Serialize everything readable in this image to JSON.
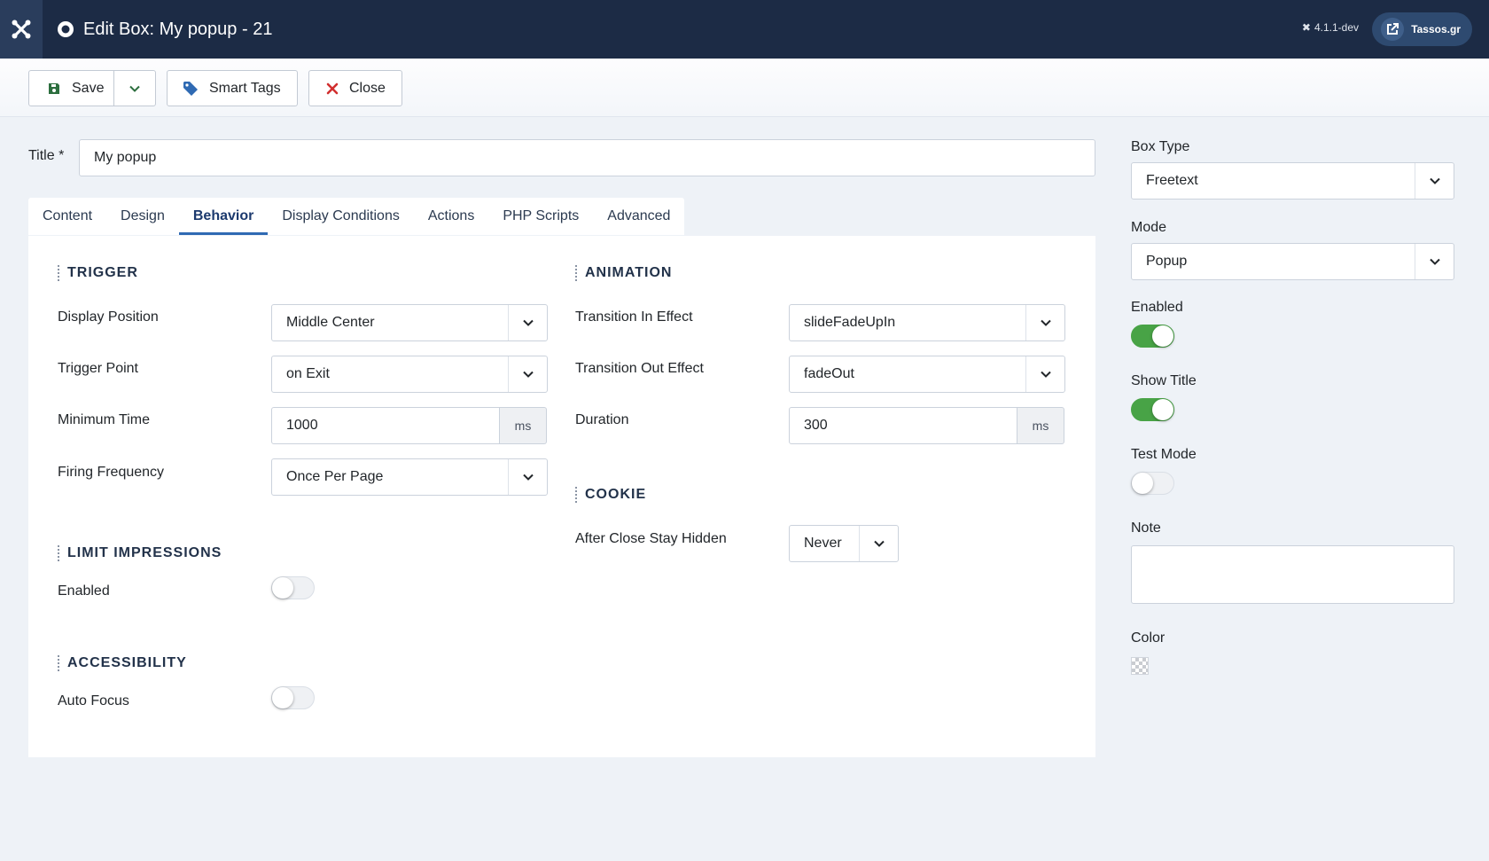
{
  "header": {
    "title": "Edit Box: My popup - 21",
    "version": "4.1.1-dev",
    "site_label": "Tassos.gr"
  },
  "toolbar": {
    "save_label": "Save",
    "smart_tags_label": "Smart Tags",
    "close_label": "Close"
  },
  "form": {
    "title_label": "Title *",
    "title_value": "My popup"
  },
  "tabs": [
    {
      "label": "Content"
    },
    {
      "label": "Design"
    },
    {
      "label": "Behavior",
      "active": true
    },
    {
      "label": "Display Conditions"
    },
    {
      "label": "Actions"
    },
    {
      "label": "PHP Scripts"
    },
    {
      "label": "Advanced"
    }
  ],
  "trigger": {
    "heading": "TRIGGER",
    "display_position_label": "Display Position",
    "display_position_value": "Middle Center",
    "trigger_point_label": "Trigger Point",
    "trigger_point_value": "on Exit",
    "minimum_time_label": "Minimum Time",
    "minimum_time_value": "1000",
    "minimum_time_unit": "ms",
    "firing_frequency_label": "Firing Frequency",
    "firing_frequency_value": "Once Per Page"
  },
  "limit_impressions": {
    "heading": "LIMIT IMPRESSIONS",
    "enabled_label": "Enabled",
    "enabled": false
  },
  "accessibility": {
    "heading": "ACCESSIBILITY",
    "auto_focus_label": "Auto Focus",
    "auto_focus": false
  },
  "animation": {
    "heading": "ANIMATION",
    "transition_in_label": "Transition In Effect",
    "transition_in_value": "slideFadeUpIn",
    "transition_out_label": "Transition Out Effect",
    "transition_out_value": "fadeOut",
    "duration_label": "Duration",
    "duration_value": "300",
    "duration_unit": "ms"
  },
  "cookie": {
    "heading": "COOKIE",
    "after_close_label": "After Close Stay Hidden",
    "after_close_value": "Never"
  },
  "sidebar": {
    "box_type_label": "Box Type",
    "box_type_value": "Freetext",
    "mode_label": "Mode",
    "mode_value": "Popup",
    "enabled_label": "Enabled",
    "enabled": true,
    "show_title_label": "Show Title",
    "show_title": true,
    "test_mode_label": "Test Mode",
    "test_mode": false,
    "note_label": "Note",
    "note_value": "",
    "color_label": "Color"
  },
  "colors": {
    "header_bg": "#1c2b45",
    "toggle_on": "#48a346",
    "active_tab": "#2f6ab3",
    "close_icon": "#d12f2f",
    "tag_icon": "#2f6ab3",
    "save_icon": "#2c6e3e"
  }
}
